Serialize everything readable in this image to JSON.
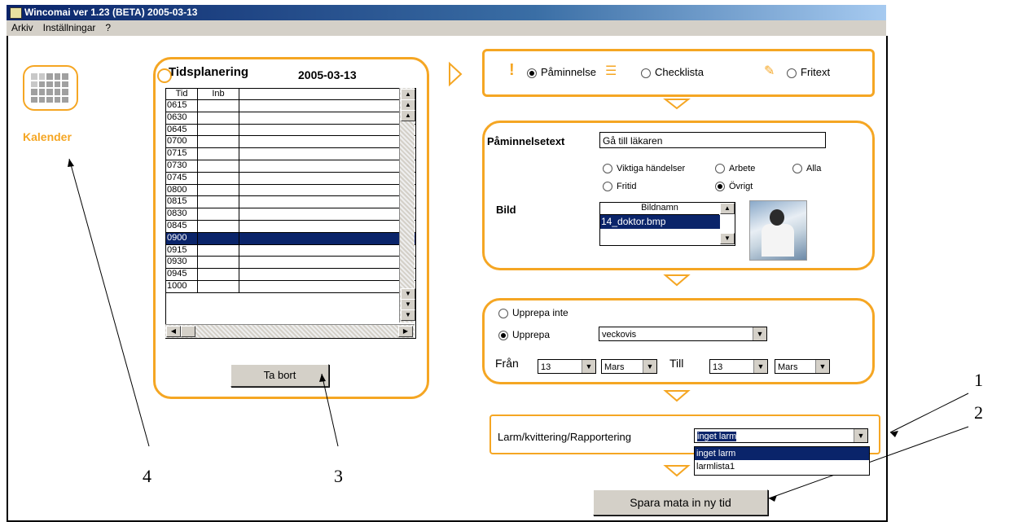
{
  "window": {
    "title": "Wincomai ver 1.23 (BETA) 2005-03-13"
  },
  "menu": {
    "items": [
      "Arkiv",
      "Inställningar",
      "?"
    ]
  },
  "sidebar": {
    "calendar_label": "Kalender"
  },
  "schedule": {
    "title": "Tidsplanering",
    "date": "2005-03-13",
    "columns": [
      "Tid",
      "Inb"
    ],
    "times": [
      "0615",
      "0630",
      "0645",
      "0700",
      "0715",
      "0730",
      "0745",
      "0800",
      "0815",
      "0830",
      "0845",
      "0900",
      "0915",
      "0930",
      "0945",
      "1000"
    ],
    "selected_time": "0900",
    "delete_button": "Ta bort"
  },
  "type_select": {
    "options": [
      "Påminnelse",
      "Checklista",
      "Fritext"
    ],
    "selected": "Påminnelse"
  },
  "reminder": {
    "label": "Påminnelsetext",
    "value": "Gå till läkaren",
    "categories": [
      "Viktiga händelser",
      "Arbete",
      "Alla",
      "Fritid",
      "Övrigt"
    ],
    "selected_category": "Övrigt",
    "image_label": "Bild",
    "image_list_header": "Bildnamn",
    "image_selected": "14_doktor.bmp"
  },
  "repeat": {
    "no_repeat_label": "Upprepa inte",
    "repeat_label": "Upprepa",
    "selected": "Upprepa",
    "frequency": "veckovis",
    "from_label": "Från",
    "from_day": "13",
    "from_month": "Mars",
    "to_label": "Till",
    "to_day": "13",
    "to_month": "Mars"
  },
  "alarm": {
    "label": "Larm/kvittering/Rapportering",
    "value": "inget larm",
    "options": [
      "inget larm",
      "larmlista1"
    ]
  },
  "save_button": "Spara mata in ny tid",
  "annotations": [
    "1",
    "2",
    "3",
    "4"
  ],
  "colors": {
    "accent": "#f5a623",
    "selection": "#0a246a"
  }
}
